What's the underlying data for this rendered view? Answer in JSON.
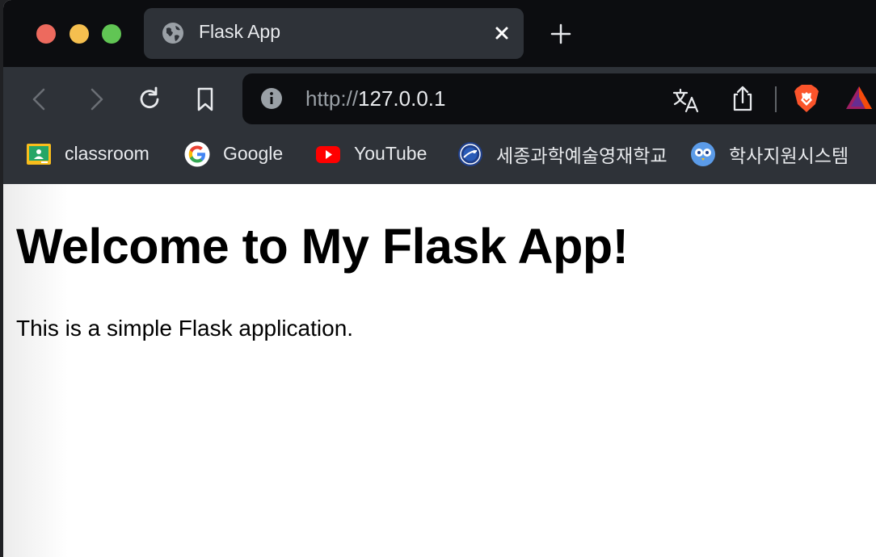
{
  "tab": {
    "title": "Flask App"
  },
  "address_bar": {
    "scheme": "http://",
    "host": "127.0.0.1"
  },
  "bookmarks": [
    {
      "label": "classroom",
      "icon": "google-classroom-icon"
    },
    {
      "label": "Google",
      "icon": "google-icon"
    },
    {
      "label": "YouTube",
      "icon": "youtube-icon"
    },
    {
      "label": "세종과학예술영재학교",
      "icon": "school-emblem-icon"
    },
    {
      "label": "학사지원시스템",
      "icon": "owl-icon"
    }
  ],
  "page": {
    "heading": "Welcome to My Flask App!",
    "paragraph": "This is a simple Flask application."
  },
  "colors": {
    "tab_strip": "#0c0d10",
    "toolbar": "#2e3238",
    "close_light": "#ed6a5e",
    "minimize_light": "#f5bf4f",
    "maximize_light": "#61c554",
    "brave_orange": "#fb542b"
  }
}
